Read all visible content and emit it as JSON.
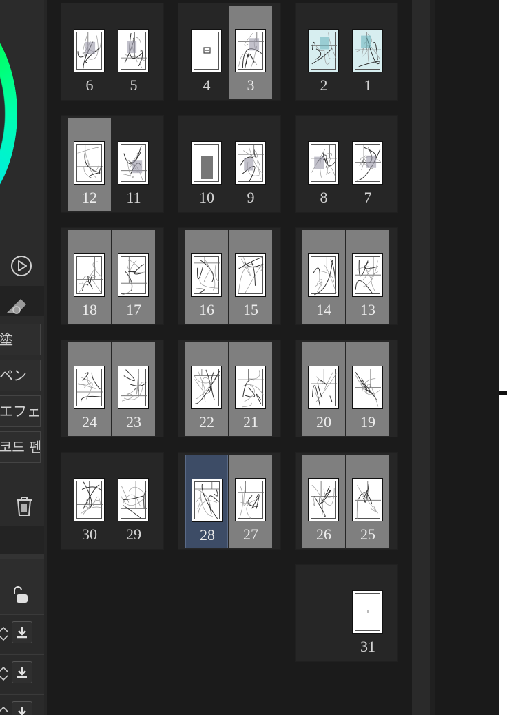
{
  "brush_list": [
    "塗",
    "ペン",
    "エフェ",
    "코드 펜"
  ],
  "icons": {
    "play": "play-circle-icon",
    "eraser": "eraser-icon",
    "trash": "trash-icon",
    "lock": "unlock-icon",
    "download": "download-icon",
    "chevron": "chevron-updown-icon"
  },
  "colors": {
    "selected_page": "#7f7f7f",
    "active_page": "#3d4c66",
    "spread_background": "#262626"
  },
  "spreads": [
    {
      "pages": [
        {
          "num": "6",
          "state": "normal"
        },
        {
          "num": "5",
          "state": "normal"
        }
      ]
    },
    {
      "pages": [
        {
          "num": "4",
          "state": "normal"
        },
        {
          "num": "3",
          "state": "selected"
        }
      ]
    },
    {
      "pages": [
        {
          "num": "2",
          "state": "normal"
        },
        {
          "num": "1",
          "state": "normal"
        }
      ]
    },
    {
      "pages": [
        {
          "num": "12",
          "state": "selected"
        },
        {
          "num": "11",
          "state": "normal"
        }
      ]
    },
    {
      "pages": [
        {
          "num": "10",
          "state": "normal"
        },
        {
          "num": "9",
          "state": "normal"
        }
      ]
    },
    {
      "pages": [
        {
          "num": "8",
          "state": "normal"
        },
        {
          "num": "7",
          "state": "normal"
        }
      ]
    },
    {
      "pages": [
        {
          "num": "18",
          "state": "selected"
        },
        {
          "num": "17",
          "state": "selected"
        }
      ]
    },
    {
      "pages": [
        {
          "num": "16",
          "state": "selected"
        },
        {
          "num": "15",
          "state": "selected"
        }
      ]
    },
    {
      "pages": [
        {
          "num": "14",
          "state": "selected"
        },
        {
          "num": "13",
          "state": "selected"
        }
      ]
    },
    {
      "pages": [
        {
          "num": "24",
          "state": "selected"
        },
        {
          "num": "23",
          "state": "selected"
        }
      ]
    },
    {
      "pages": [
        {
          "num": "22",
          "state": "selected"
        },
        {
          "num": "21",
          "state": "selected"
        }
      ]
    },
    {
      "pages": [
        {
          "num": "20",
          "state": "selected"
        },
        {
          "num": "19",
          "state": "selected"
        }
      ]
    },
    {
      "pages": [
        {
          "num": "30",
          "state": "normal"
        },
        {
          "num": "29",
          "state": "normal"
        }
      ]
    },
    {
      "pages": [
        {
          "num": "28",
          "state": "active"
        },
        {
          "num": "27",
          "state": "selected"
        }
      ]
    },
    {
      "pages": [
        {
          "num": "26",
          "state": "selected"
        },
        {
          "num": "25",
          "state": "selected"
        }
      ]
    },
    {
      "pages": [
        {
          "num": "31",
          "state": "normal"
        }
      ]
    }
  ]
}
